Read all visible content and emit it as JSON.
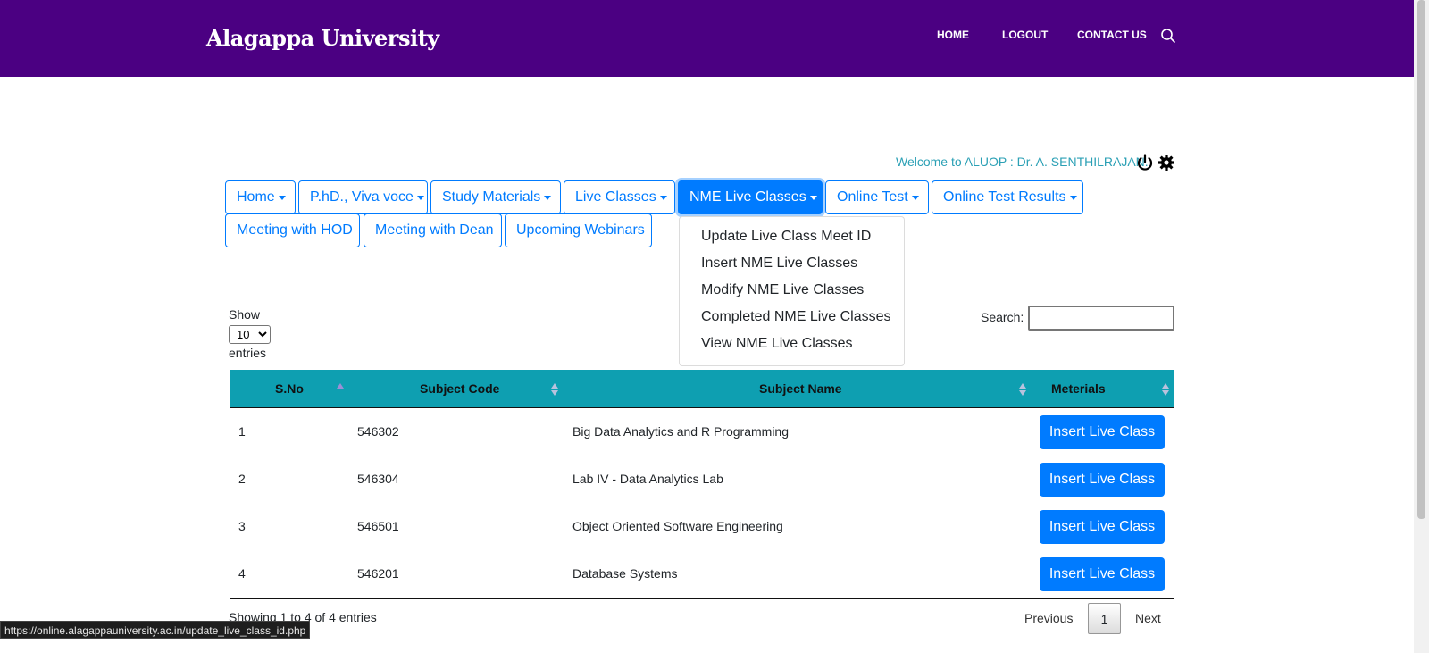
{
  "header": {
    "brand": "Alagappa University",
    "nav": [
      "HOME",
      "LOGOUT",
      "CONTACT US"
    ],
    "search_icon": "search-icon",
    "background_color": "#4b0082"
  },
  "welcome": {
    "text": "Welcome to ALUOP : Dr. A. SENTHILRAJAN.",
    "icons": [
      "power-icon",
      "gear-icon"
    ]
  },
  "menu": {
    "items": [
      "Home",
      "P.hD., Viva voce",
      "Study Materials",
      "Live Classes",
      "NME Live Classes",
      "Online Test",
      "Online Test Results",
      "Meeting with HOD",
      "Meeting with Dean",
      "Upcoming Webinars"
    ],
    "active": "NME Live Classes",
    "dropdown": [
      "Update Live Class Meet ID",
      "Insert NME Live Classes",
      "Modify NME Live Classes",
      "Completed NME Live Classes",
      "View NME Live Classes"
    ]
  },
  "table_controls": {
    "show_label": "Show",
    "entries_value": "10",
    "entries_label": "entries",
    "search_label": "Search:",
    "search_value": ""
  },
  "table": {
    "columns": [
      "S.No",
      "Subject Code",
      "Subject Name",
      "Meterials"
    ],
    "rows": [
      {
        "sno": "1",
        "code": "546302",
        "name": "Big Data Analytics and R Programming",
        "action": "Insert Live Class"
      },
      {
        "sno": "2",
        "code": "546304",
        "name": "Lab IV - Data Analytics Lab",
        "action": "Insert Live Class"
      },
      {
        "sno": "3",
        "code": "546501",
        "name": "Object Oriented Software Engineering",
        "action": "Insert Live Class"
      },
      {
        "sno": "4",
        "code": "546201",
        "name": "Database Systems",
        "action": "Insert Live Class"
      }
    ],
    "header_color": "#0e9fb1",
    "button_color": "#007bff"
  },
  "footer": {
    "info": "Showing 1 to 4 of 4 entries",
    "previous": "Previous",
    "page": "1",
    "next": "Next"
  },
  "status_bar": {
    "url": "https://online.alagappauniversity.ac.in/update_live_class_id.php"
  }
}
